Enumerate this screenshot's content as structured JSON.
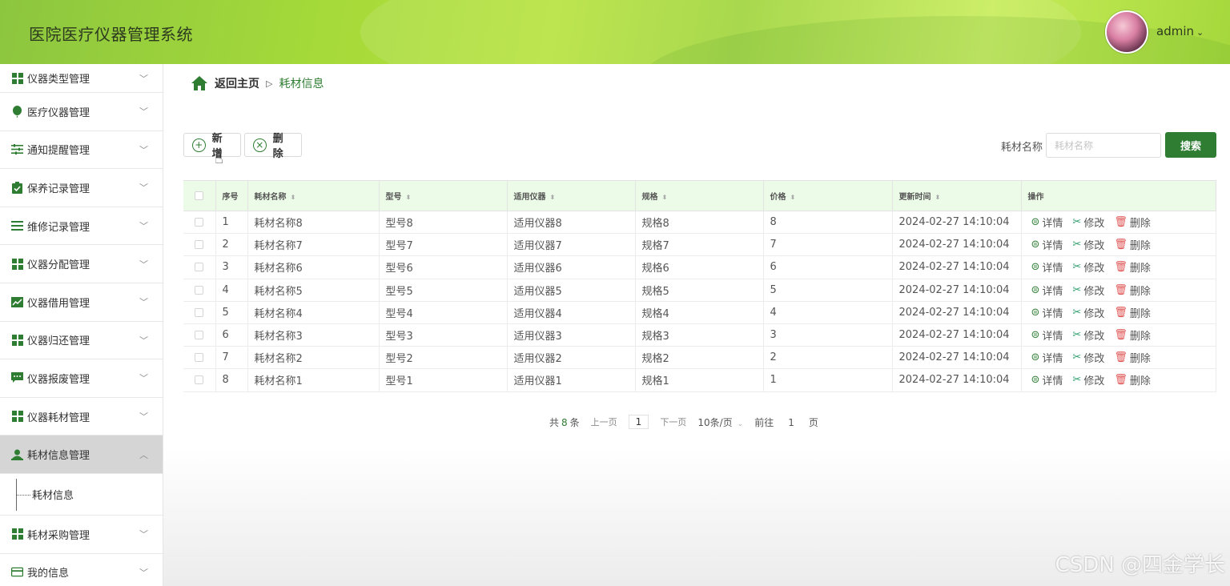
{
  "header": {
    "title": "医院医疗仪器管理系统",
    "username": "admin"
  },
  "sidebar": {
    "items": [
      {
        "label": "仪器类型管理",
        "icon": "grid-icon"
      },
      {
        "label": "医疗仪器管理",
        "icon": "balloon-icon"
      },
      {
        "label": "通知提醒管理",
        "icon": "sliders-icon"
      },
      {
        "label": "保养记录管理",
        "icon": "clipboard-check-icon"
      },
      {
        "label": "维修记录管理",
        "icon": "list-icon"
      },
      {
        "label": "仪器分配管理",
        "icon": "grid-icon"
      },
      {
        "label": "仪器借用管理",
        "icon": "chart-line-icon"
      },
      {
        "label": "仪器归还管理",
        "icon": "grid-icon"
      },
      {
        "label": "仪器报废管理",
        "icon": "chat-icon"
      },
      {
        "label": "仪器耗材管理",
        "icon": "grid-icon"
      },
      {
        "label": "耗材信息管理",
        "icon": "person-icon",
        "active": true
      },
      {
        "label": "耗材采购管理",
        "icon": "grid-icon"
      },
      {
        "label": "我的信息",
        "icon": "card-icon"
      }
    ],
    "submenu_label": "耗材信息"
  },
  "breadcrumb": {
    "home": "返回主页",
    "separator": "▷",
    "current": "耗材信息"
  },
  "toolbar": {
    "add_label": "新增",
    "delete_label": "删除",
    "search_label": "耗材名称",
    "search_placeholder": "耗材名称",
    "search_button": "搜索"
  },
  "table": {
    "headers": [
      "序号",
      "耗材名称",
      "型号",
      "适用仪器",
      "规格",
      "价格",
      "更新时间",
      "操作"
    ],
    "rows": [
      {
        "no": "1",
        "name": "耗材名称8",
        "model": "型号8",
        "device": "适用仪器8",
        "spec": "规格8",
        "price": "8",
        "time": "2024-02-27 14:10:04"
      },
      {
        "no": "2",
        "name": "耗材名称7",
        "model": "型号7",
        "device": "适用仪器7",
        "spec": "规格7",
        "price": "7",
        "time": "2024-02-27 14:10:04"
      },
      {
        "no": "3",
        "name": "耗材名称6",
        "model": "型号6",
        "device": "适用仪器6",
        "spec": "规格6",
        "price": "6",
        "time": "2024-02-27 14:10:04"
      },
      {
        "no": "4",
        "name": "耗材名称5",
        "model": "型号5",
        "device": "适用仪器5",
        "spec": "规格5",
        "price": "5",
        "time": "2024-02-27 14:10:04"
      },
      {
        "no": "5",
        "name": "耗材名称4",
        "model": "型号4",
        "device": "适用仪器4",
        "spec": "规格4",
        "price": "4",
        "time": "2024-02-27 14:10:04"
      },
      {
        "no": "6",
        "name": "耗材名称3",
        "model": "型号3",
        "device": "适用仪器3",
        "spec": "规格3",
        "price": "3",
        "time": "2024-02-27 14:10:04"
      },
      {
        "no": "7",
        "name": "耗材名称2",
        "model": "型号2",
        "device": "适用仪器2",
        "spec": "规格2",
        "price": "2",
        "time": "2024-02-27 14:10:04"
      },
      {
        "no": "8",
        "name": "耗材名称1",
        "model": "型号1",
        "device": "适用仪器1",
        "spec": "规格1",
        "price": "1",
        "time": "2024-02-27 14:10:04"
      }
    ],
    "actions": {
      "detail": "详情",
      "edit": "修改",
      "delete": "删除"
    }
  },
  "pagination": {
    "total_prefix": "共",
    "total": "8",
    "total_suffix": "条",
    "prev": "上一页",
    "current_page": "1",
    "next": "下一页",
    "page_size": "10条/页",
    "goto_prefix": "前往",
    "goto_value": "1",
    "goto_suffix": "页"
  },
  "watermark": "CSDN @四金学长",
  "colors": {
    "accent": "#2e7d32",
    "header_green": "#a4d93a",
    "table_header_bg": "#ecfbe7",
    "delete_red": "#e05252"
  }
}
